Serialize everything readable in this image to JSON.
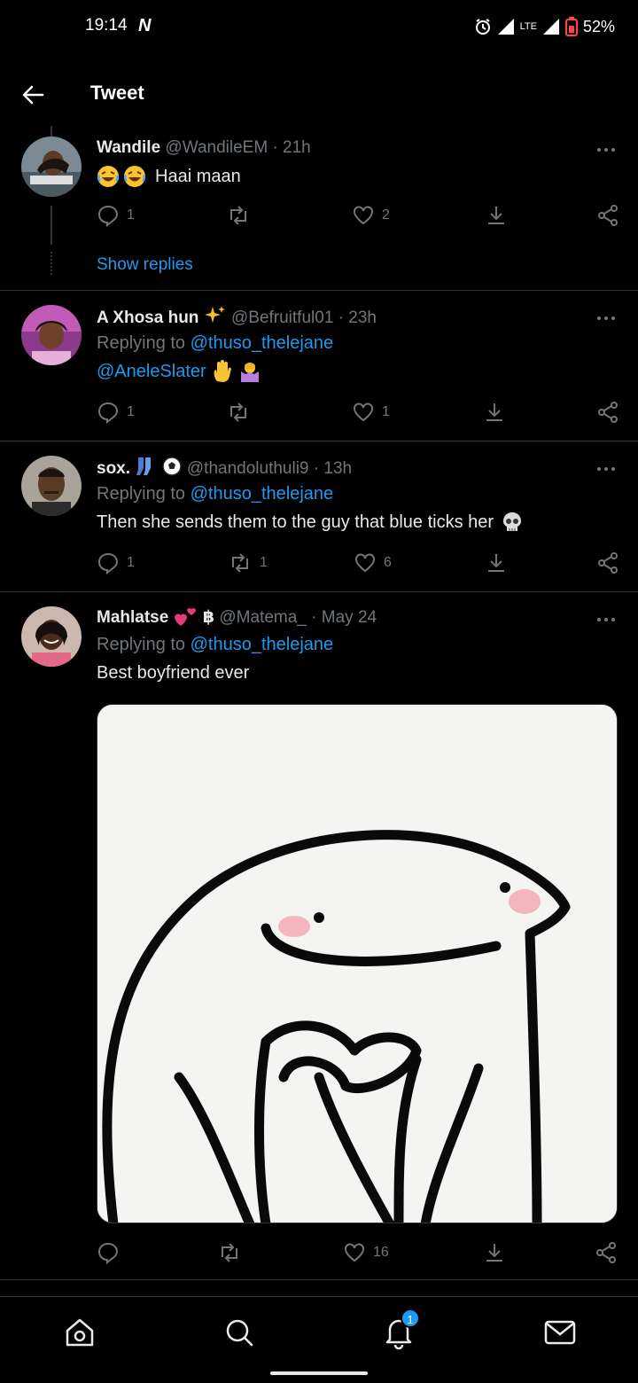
{
  "status_bar": {
    "time": "19:14",
    "carrier_icon": "N",
    "network": "LTE",
    "battery": "52%"
  },
  "header": {
    "title": "Tweet"
  },
  "tweets": [
    {
      "name": "Wandile",
      "handle": "@WandileEM",
      "time": "· 21h",
      "text": "Haai maan",
      "replies": "1",
      "retweets": "",
      "likes": "2",
      "show_replies": "Show replies"
    },
    {
      "name": "A Xhosa hun",
      "handle": "@Befruitful01",
      "time": "· 23h",
      "replying_prefix": "Replying to",
      "replying_to": "@thuso_thelejane",
      "text": "@AneleSlater",
      "replies": "1",
      "retweets": "",
      "likes": "1"
    },
    {
      "name": "sox.",
      "handle": "@thandoluthuli9",
      "time": "· 13h",
      "replying_prefix": "Replying to",
      "replying_to": "@thuso_thelejane",
      "text": "Then she sends them to the guy that blue ticks her",
      "replies": "1",
      "retweets": "1",
      "likes": "6"
    },
    {
      "name": "Mahlatse",
      "name_suffix": "฿",
      "handle": "@Matema_",
      "time": "· May 24",
      "replying_prefix": "Replying to",
      "replying_to": "@thuso_thelejane",
      "text": "Best boyfriend ever",
      "replies": "",
      "retweets": "",
      "likes": "16"
    }
  ],
  "bottom_nav": {
    "notifications_badge": "1"
  },
  "colors": {
    "background": "#000000",
    "accent": "#1d9bf0",
    "muted": "#71767b",
    "text": "#e7e9ea",
    "divider": "#2f3336"
  }
}
